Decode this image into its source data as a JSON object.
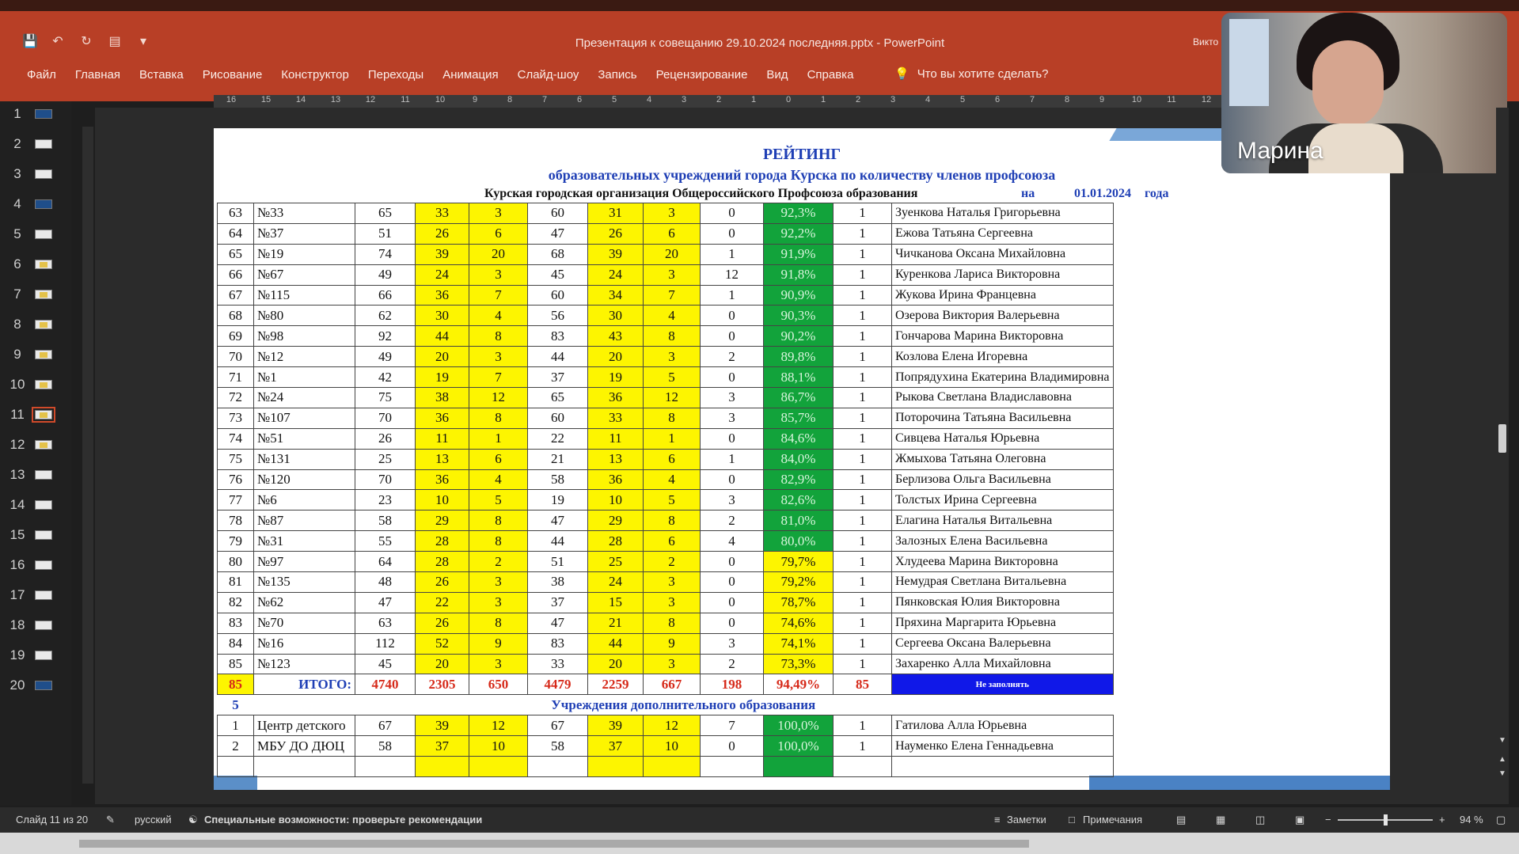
{
  "window": {
    "title": "Презентация к совещанию 29.10.2024 последняя.pptx  -  PowerPoint",
    "user_fragment": "Викто"
  },
  "ribbon": {
    "tabs": [
      "Файл",
      "Главная",
      "Вставка",
      "Рисование",
      "Конструктор",
      "Переходы",
      "Анимация",
      "Слайд-шоу",
      "Запись",
      "Рецензирование",
      "Вид",
      "Справка"
    ],
    "tell_me": "Что вы хотите сделать?"
  },
  "ruler": [
    "16",
    "15",
    "14",
    "13",
    "12",
    "11",
    "10",
    "9",
    "8",
    "7",
    "6",
    "5",
    "4",
    "3",
    "2",
    "1",
    "0",
    "1",
    "2",
    "3",
    "4",
    "5",
    "6",
    "7",
    "8",
    "9",
    "10",
    "11",
    "12"
  ],
  "slides": {
    "numbers": [
      "1",
      "2",
      "3",
      "4",
      "5",
      "6",
      "7",
      "8",
      "9",
      "10",
      "11",
      "12",
      "13",
      "14",
      "15",
      "16",
      "17",
      "18",
      "19",
      "20"
    ],
    "selected": "11"
  },
  "slide": {
    "title": "РЕЙТИНГ",
    "subtitle": "образовательных учреждений города Курска по количеству членов профсоюза",
    "org_line": "Курская городская организация Общероссийского Профсоюза образования",
    "na": "на",
    "date": "01.01.2024",
    "goda": "года",
    "rows": [
      [
        "63",
        "№33",
        "65",
        "33",
        "3",
        "60",
        "31",
        "3",
        "0",
        "92,3%",
        "1",
        "Зуенкова Наталья Григорьевна"
      ],
      [
        "64",
        "№37",
        "51",
        "26",
        "6",
        "47",
        "26",
        "6",
        "0",
        "92,2%",
        "1",
        "Ежова Татьяна Сергеевна"
      ],
      [
        "65",
        "№19",
        "74",
        "39",
        "20",
        "68",
        "39",
        "20",
        "1",
        "91,9%",
        "1",
        "Чичканова Оксана Михайловна"
      ],
      [
        "66",
        "№67",
        "49",
        "24",
        "3",
        "45",
        "24",
        "3",
        "12",
        "91,8%",
        "1",
        "Куренкова Лариса Викторовна"
      ],
      [
        "67",
        "№115",
        "66",
        "36",
        "7",
        "60",
        "34",
        "7",
        "1",
        "90,9%",
        "1",
        "Жукова Ирина Францевна"
      ],
      [
        "68",
        "№80",
        "62",
        "30",
        "4",
        "56",
        "30",
        "4",
        "0",
        "90,3%",
        "1",
        "Озерова Виктория Валерьевна"
      ],
      [
        "69",
        "№98",
        "92",
        "44",
        "8",
        "83",
        "43",
        "8",
        "0",
        "90,2%",
        "1",
        "Гончарова Марина Викторовна"
      ],
      [
        "70",
        "№12",
        "49",
        "20",
        "3",
        "44",
        "20",
        "3",
        "2",
        "89,8%",
        "1",
        "Козлова Елена Игоревна"
      ],
      [
        "71",
        "№1",
        "42",
        "19",
        "7",
        "37",
        "19",
        "5",
        "0",
        "88,1%",
        "1",
        "Попрядухина Екатерина Владимировна"
      ],
      [
        "72",
        "№24",
        "75",
        "38",
        "12",
        "65",
        "36",
        "12",
        "3",
        "86,7%",
        "1",
        "Рыкова Светлана Владиславовна"
      ],
      [
        "73",
        "№107",
        "70",
        "36",
        "8",
        "60",
        "33",
        "8",
        "3",
        "85,7%",
        "1",
        "Поторочина Татьяна Васильевна"
      ],
      [
        "74",
        "№51",
        "26",
        "11",
        "1",
        "22",
        "11",
        "1",
        "0",
        "84,6%",
        "1",
        "Сивцева Наталья Юрьевна"
      ],
      [
        "75",
        "№131",
        "25",
        "13",
        "6",
        "21",
        "13",
        "6",
        "1",
        "84,0%",
        "1",
        "Жмыхова Татьяна Олеговна"
      ],
      [
        "76",
        "№120",
        "70",
        "36",
        "4",
        "58",
        "36",
        "4",
        "0",
        "82,9%",
        "1",
        "Берлизова Ольга Васильевна"
      ],
      [
        "77",
        "№6",
        "23",
        "10",
        "5",
        "19",
        "10",
        "5",
        "3",
        "82,6%",
        "1",
        "Толстых Ирина Сергеевна"
      ],
      [
        "78",
        "№87",
        "58",
        "29",
        "8",
        "47",
        "29",
        "8",
        "2",
        "81,0%",
        "1",
        "Елагина Наталья Витальевна"
      ],
      [
        "79",
        "№31",
        "55",
        "28",
        "8",
        "44",
        "28",
        "6",
        "4",
        "80,0%",
        "1",
        "Залозных Елена Васильевна"
      ],
      [
        "80",
        "№97",
        "64",
        "28",
        "2",
        "51",
        "25",
        "2",
        "0",
        "79,7%",
        "1",
        "Хлудеева Марина Викторовна"
      ],
      [
        "81",
        "№135",
        "48",
        "26",
        "3",
        "38",
        "24",
        "3",
        "0",
        "79,2%",
        "1",
        "Немудрая Светлана Витальевна"
      ],
      [
        "82",
        "№62",
        "47",
        "22",
        "3",
        "37",
        "15",
        "3",
        "0",
        "78,7%",
        "1",
        "Пянковская Юлия Викторовна"
      ],
      [
        "83",
        "№70",
        "63",
        "26",
        "8",
        "47",
        "21",
        "8",
        "0",
        "74,6%",
        "1",
        "Пряхина Маргарита Юрьевна"
      ],
      [
        "84",
        "№16",
        "112",
        "52",
        "9",
        "83",
        "44",
        "9",
        "3",
        "74,1%",
        "1",
        "Сергеева Оксана Валерьевна"
      ],
      [
        "85",
        "№123",
        "45",
        "20",
        "3",
        "33",
        "20",
        "3",
        "2",
        "73,3%",
        "1",
        "Захаренко Алла Михайловна"
      ]
    ],
    "green_threshold_rows": 17,
    "total": {
      "count": "85",
      "label": "ИТОГО:",
      "values": [
        "4740",
        "2305",
        "650",
        "4479",
        "2259",
        "667",
        "198",
        "94,49%",
        "85"
      ],
      "note": "Не заполнять"
    },
    "section": {
      "count": "5",
      "title": "Учреждения дополнительного образования"
    },
    "extra_rows": [
      [
        "1",
        "Центр детского",
        "67",
        "39",
        "12",
        "67",
        "39",
        "12",
        "7",
        "100,0%",
        "1",
        "Гатилова Алла Юрьевна"
      ],
      [
        "2",
        "МБУ ДО ДЮЦ",
        "58",
        "37",
        "10",
        "58",
        "37",
        "10",
        "0",
        "100,0%",
        "1",
        "Науменко Елена Геннадьевна"
      ]
    ]
  },
  "webcam": {
    "name": "Марина"
  },
  "status": {
    "slide_counter": "Слайд 11 из 20",
    "language": "русский",
    "accessibility": "Специальные возможности: проверьте рекомендации",
    "notes": "Заметки",
    "comments": "Примечания",
    "zoom": "94 %",
    "zoom_level": 0.5
  },
  "colors": {
    "ribbon": "#b83f26",
    "highlight_yellow": "#fdf500",
    "highlight_green": "#12a33b",
    "heading_blue": "#1f3fb5",
    "total_blue": "#1018e8",
    "total_red": "#d62a1a"
  }
}
